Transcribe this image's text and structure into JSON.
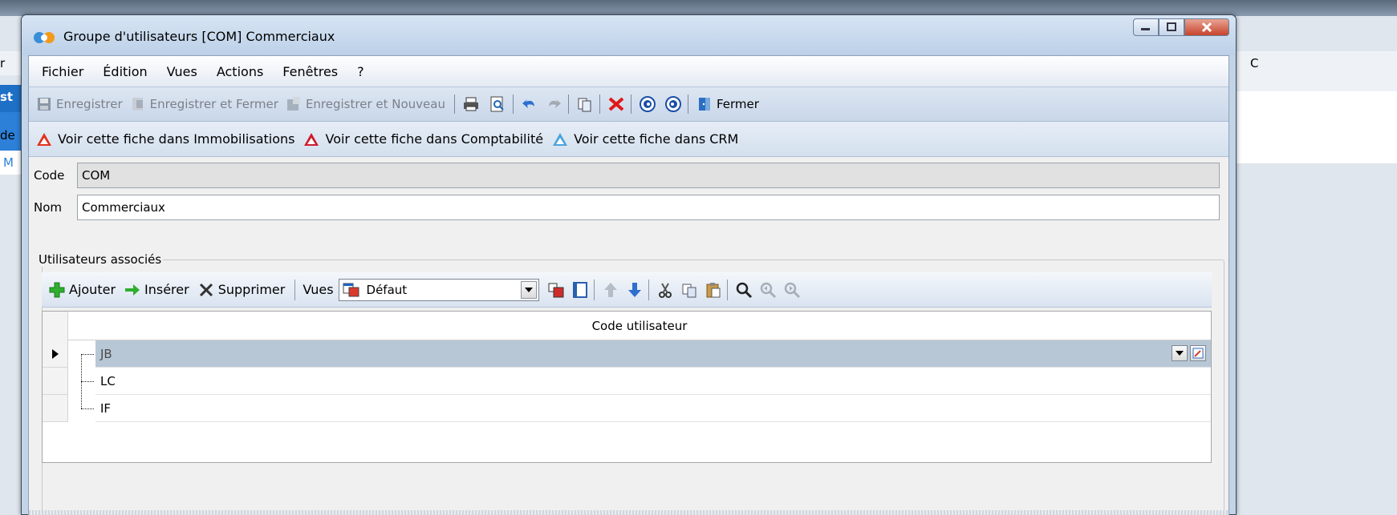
{
  "window": {
    "title": "Groupe d'utilisateurs [COM] Commerciaux",
    "controls": [
      "minimize",
      "maximize",
      "close"
    ]
  },
  "menu": [
    "Fichier",
    "Édition",
    "Vues",
    "Actions",
    "Fenêtres",
    "?"
  ],
  "toolbar": {
    "save_label": "Enregistrer",
    "save_close_label": "Enregistrer et Fermer",
    "save_new_label": "Enregistrer et Nouveau",
    "close_label": "Fermer"
  },
  "links": [
    "Voir cette fiche dans Immobilisations",
    "Voir cette fiche dans Comptabilité",
    "Voir cette fiche dans CRM"
  ],
  "form": {
    "code_label": "Code",
    "code_value": "COM",
    "nom_label": "Nom",
    "nom_value": "Commerciaux"
  },
  "associated_users": {
    "group_label": "Utilisateurs associés",
    "add_label": "Ajouter",
    "insert_label": "Insérer",
    "delete_label": "Supprimer",
    "views_label": "Vues",
    "view_selected": "Défaut",
    "column_header": "Code utilisateur",
    "rows": [
      "JB",
      "LC",
      "IF"
    ]
  },
  "background": {
    "left_chars": [
      "r",
      "st",
      "de",
      "M"
    ],
    "right_chars": [
      "C"
    ]
  },
  "colors": {
    "selected_row": "#b8c7d6",
    "close_button": "#c7442c",
    "toolbar_bg": "#c9d7ea"
  }
}
